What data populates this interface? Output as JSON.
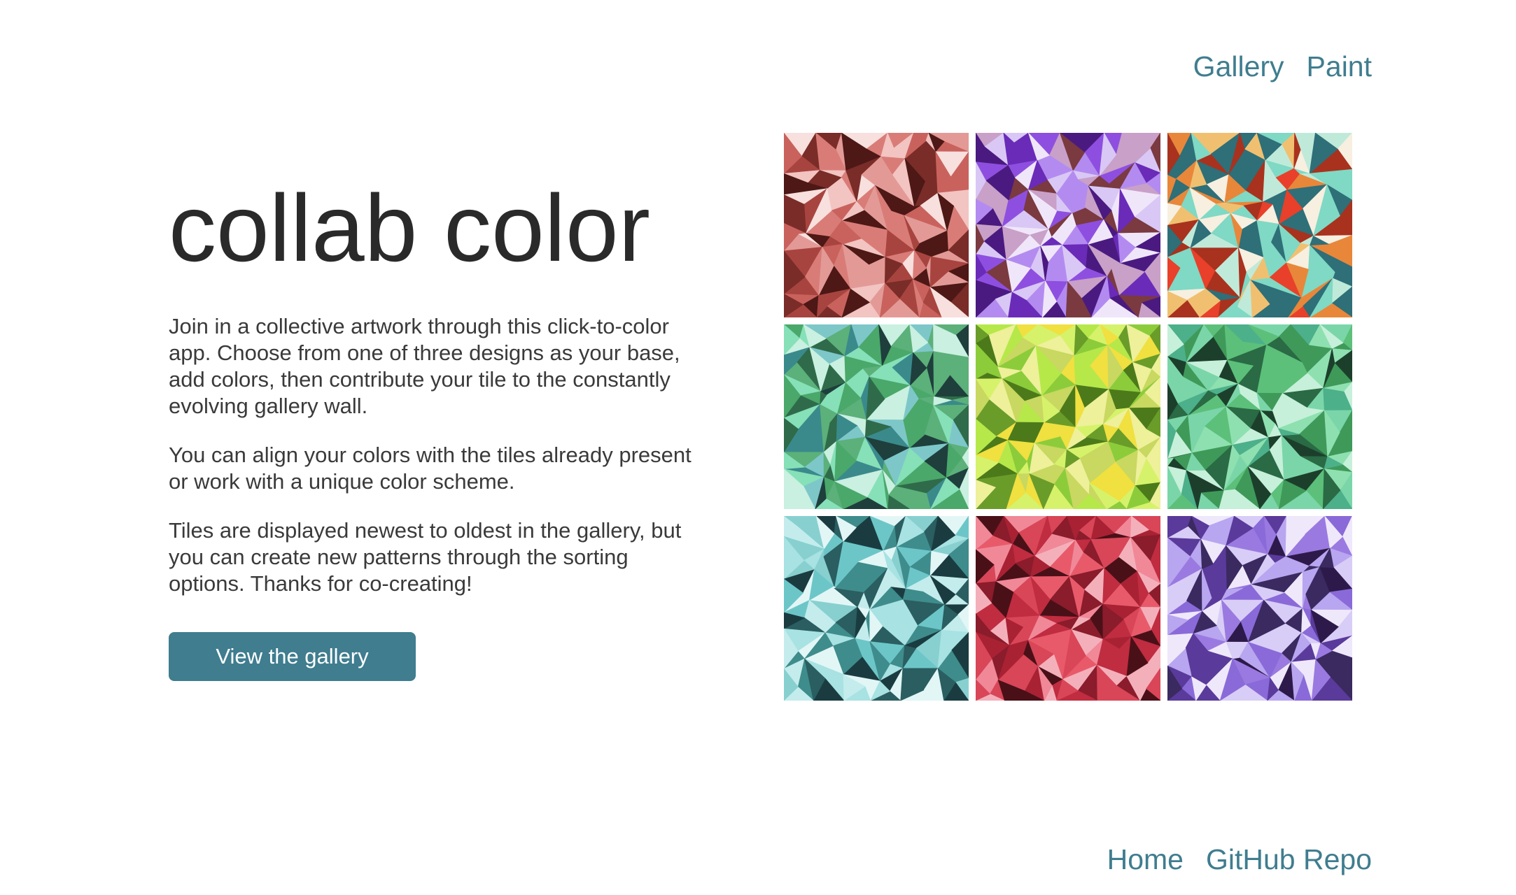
{
  "nav": {
    "gallery": "Gallery",
    "paint": "Paint"
  },
  "hero": {
    "title": "collab color",
    "paragraphs": [
      "Join in a collective artwork through this click-to-color app. Choose from one of three designs as your base, add colors, then contribute your tile to the constantly evolving gallery wall.",
      "You can align your colors with the tiles already present or work with a unique color scheme.",
      "Tiles are displayed newest to oldest in the gallery, but you can create new patterns through the sorting options. Thanks for co-creating!"
    ],
    "cta_label": "View the gallery"
  },
  "tiles": [
    {
      "palette": [
        "#f2c4c2",
        "#e39a96",
        "#c9625d",
        "#a8443f",
        "#7a2c28",
        "#4d1815",
        "#f7e0de",
        "#d97c77"
      ]
    },
    {
      "palette": [
        "#d9c8f5",
        "#b38bf0",
        "#8e4fe0",
        "#6a2bb8",
        "#4a1a80",
        "#c9a0c8",
        "#f0e6fa",
        "#7a3a40"
      ]
    },
    {
      "palette": [
        "#7fd9c4",
        "#bfead9",
        "#e8402a",
        "#e8873a",
        "#f0c070",
        "#2e6f78",
        "#f7efe0",
        "#a8321e"
      ]
    },
    {
      "palette": [
        "#7dc7c9",
        "#86e0b8",
        "#4aa86a",
        "#2f6b4a",
        "#1e3f3c",
        "#c9f0e0",
        "#5cb07a",
        "#3a8a8c"
      ]
    },
    {
      "palette": [
        "#d6f26a",
        "#b6e84a",
        "#8ccc3a",
        "#6a9c2a",
        "#f0e040",
        "#eef09a",
        "#4c7a1a",
        "#c8d860"
      ]
    },
    {
      "palette": [
        "#8fe0b0",
        "#5cc07a",
        "#3f9a5a",
        "#2a6a44",
        "#1c3f2c",
        "#c6f0da",
        "#7ad6a8",
        "#4cb08a"
      ]
    },
    {
      "palette": [
        "#6cc6c8",
        "#a8e2e2",
        "#e2f6f6",
        "#3f8c8c",
        "#2a5e60",
        "#1a3c40",
        "#88d0d0",
        "#c4ecec"
      ]
    },
    {
      "palette": [
        "#e85a6a",
        "#f08898",
        "#c02c40",
        "#8a1c2c",
        "#4a1018",
        "#f4b0ba",
        "#d84658",
        "#a82234"
      ]
    },
    {
      "palette": [
        "#b8a6f0",
        "#d8cdf7",
        "#8a6ad8",
        "#5a3a9a",
        "#2e1a4a",
        "#efe8fb",
        "#9a7ae0",
        "#3a2a60"
      ]
    }
  ]
}
